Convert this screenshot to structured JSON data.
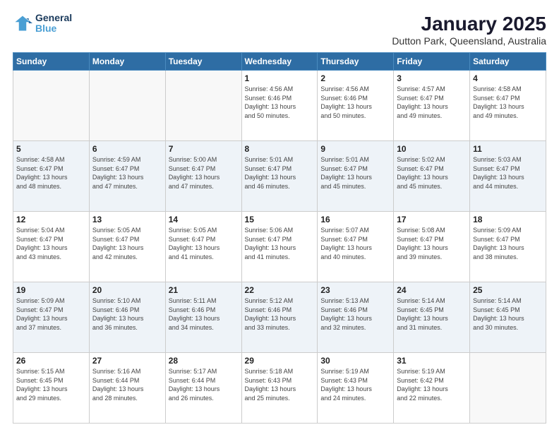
{
  "logo": {
    "line1": "General",
    "line2": "Blue"
  },
  "title": "January 2025",
  "subtitle": "Dutton Park, Queensland, Australia",
  "days_header": [
    "Sunday",
    "Monday",
    "Tuesday",
    "Wednesday",
    "Thursday",
    "Friday",
    "Saturday"
  ],
  "weeks": [
    [
      {
        "num": "",
        "info": ""
      },
      {
        "num": "",
        "info": ""
      },
      {
        "num": "",
        "info": ""
      },
      {
        "num": "1",
        "info": "Sunrise: 4:56 AM\nSunset: 6:46 PM\nDaylight: 13 hours\nand 50 minutes."
      },
      {
        "num": "2",
        "info": "Sunrise: 4:56 AM\nSunset: 6:46 PM\nDaylight: 13 hours\nand 50 minutes."
      },
      {
        "num": "3",
        "info": "Sunrise: 4:57 AM\nSunset: 6:47 PM\nDaylight: 13 hours\nand 49 minutes."
      },
      {
        "num": "4",
        "info": "Sunrise: 4:58 AM\nSunset: 6:47 PM\nDaylight: 13 hours\nand 49 minutes."
      }
    ],
    [
      {
        "num": "5",
        "info": "Sunrise: 4:58 AM\nSunset: 6:47 PM\nDaylight: 13 hours\nand 48 minutes."
      },
      {
        "num": "6",
        "info": "Sunrise: 4:59 AM\nSunset: 6:47 PM\nDaylight: 13 hours\nand 47 minutes."
      },
      {
        "num": "7",
        "info": "Sunrise: 5:00 AM\nSunset: 6:47 PM\nDaylight: 13 hours\nand 47 minutes."
      },
      {
        "num": "8",
        "info": "Sunrise: 5:01 AM\nSunset: 6:47 PM\nDaylight: 13 hours\nand 46 minutes."
      },
      {
        "num": "9",
        "info": "Sunrise: 5:01 AM\nSunset: 6:47 PM\nDaylight: 13 hours\nand 45 minutes."
      },
      {
        "num": "10",
        "info": "Sunrise: 5:02 AM\nSunset: 6:47 PM\nDaylight: 13 hours\nand 45 minutes."
      },
      {
        "num": "11",
        "info": "Sunrise: 5:03 AM\nSunset: 6:47 PM\nDaylight: 13 hours\nand 44 minutes."
      }
    ],
    [
      {
        "num": "12",
        "info": "Sunrise: 5:04 AM\nSunset: 6:47 PM\nDaylight: 13 hours\nand 43 minutes."
      },
      {
        "num": "13",
        "info": "Sunrise: 5:05 AM\nSunset: 6:47 PM\nDaylight: 13 hours\nand 42 minutes."
      },
      {
        "num": "14",
        "info": "Sunrise: 5:05 AM\nSunset: 6:47 PM\nDaylight: 13 hours\nand 41 minutes."
      },
      {
        "num": "15",
        "info": "Sunrise: 5:06 AM\nSunset: 6:47 PM\nDaylight: 13 hours\nand 41 minutes."
      },
      {
        "num": "16",
        "info": "Sunrise: 5:07 AM\nSunset: 6:47 PM\nDaylight: 13 hours\nand 40 minutes."
      },
      {
        "num": "17",
        "info": "Sunrise: 5:08 AM\nSunset: 6:47 PM\nDaylight: 13 hours\nand 39 minutes."
      },
      {
        "num": "18",
        "info": "Sunrise: 5:09 AM\nSunset: 6:47 PM\nDaylight: 13 hours\nand 38 minutes."
      }
    ],
    [
      {
        "num": "19",
        "info": "Sunrise: 5:09 AM\nSunset: 6:47 PM\nDaylight: 13 hours\nand 37 minutes."
      },
      {
        "num": "20",
        "info": "Sunrise: 5:10 AM\nSunset: 6:46 PM\nDaylight: 13 hours\nand 36 minutes."
      },
      {
        "num": "21",
        "info": "Sunrise: 5:11 AM\nSunset: 6:46 PM\nDaylight: 13 hours\nand 34 minutes."
      },
      {
        "num": "22",
        "info": "Sunrise: 5:12 AM\nSunset: 6:46 PM\nDaylight: 13 hours\nand 33 minutes."
      },
      {
        "num": "23",
        "info": "Sunrise: 5:13 AM\nSunset: 6:46 PM\nDaylight: 13 hours\nand 32 minutes."
      },
      {
        "num": "24",
        "info": "Sunrise: 5:14 AM\nSunset: 6:45 PM\nDaylight: 13 hours\nand 31 minutes."
      },
      {
        "num": "25",
        "info": "Sunrise: 5:14 AM\nSunset: 6:45 PM\nDaylight: 13 hours\nand 30 minutes."
      }
    ],
    [
      {
        "num": "26",
        "info": "Sunrise: 5:15 AM\nSunset: 6:45 PM\nDaylight: 13 hours\nand 29 minutes."
      },
      {
        "num": "27",
        "info": "Sunrise: 5:16 AM\nSunset: 6:44 PM\nDaylight: 13 hours\nand 28 minutes."
      },
      {
        "num": "28",
        "info": "Sunrise: 5:17 AM\nSunset: 6:44 PM\nDaylight: 13 hours\nand 26 minutes."
      },
      {
        "num": "29",
        "info": "Sunrise: 5:18 AM\nSunset: 6:43 PM\nDaylight: 13 hours\nand 25 minutes."
      },
      {
        "num": "30",
        "info": "Sunrise: 5:19 AM\nSunset: 6:43 PM\nDaylight: 13 hours\nand 24 minutes."
      },
      {
        "num": "31",
        "info": "Sunrise: 5:19 AM\nSunset: 6:42 PM\nDaylight: 13 hours\nand 22 minutes."
      },
      {
        "num": "",
        "info": ""
      }
    ]
  ],
  "colors": {
    "header_bg": "#2e6da4",
    "header_text": "#ffffff",
    "logo_dark": "#1a3a5c",
    "logo_blue": "#4a9fd4"
  }
}
